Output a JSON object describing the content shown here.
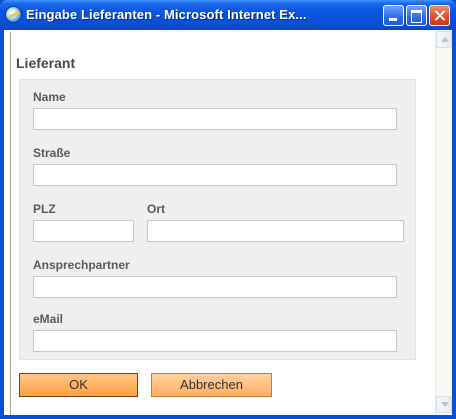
{
  "window": {
    "title": "Eingabe Lieferanten - Microsoft Internet Ex...",
    "icon": "internet-explorer-icon",
    "controls": [
      "minimize-icon",
      "maximize-icon",
      "close-icon"
    ]
  },
  "form": {
    "section_title": "Lieferant",
    "fields": {
      "name": {
        "label": "Name",
        "value": ""
      },
      "strasse": {
        "label": "Straße",
        "value": ""
      },
      "plz": {
        "label": "PLZ",
        "value": ""
      },
      "ort": {
        "label": "Ort",
        "value": ""
      },
      "ansprechpartner": {
        "label": "Ansprechpartner",
        "value": ""
      },
      "email": {
        "label": "eMail",
        "value": ""
      }
    },
    "buttons": {
      "ok": "OK",
      "cancel": "Abbrechen"
    }
  },
  "colors": {
    "title_bar": "#0a4fd4",
    "button_orange": "#ff9f3f",
    "panel_bg": "#efefef"
  }
}
